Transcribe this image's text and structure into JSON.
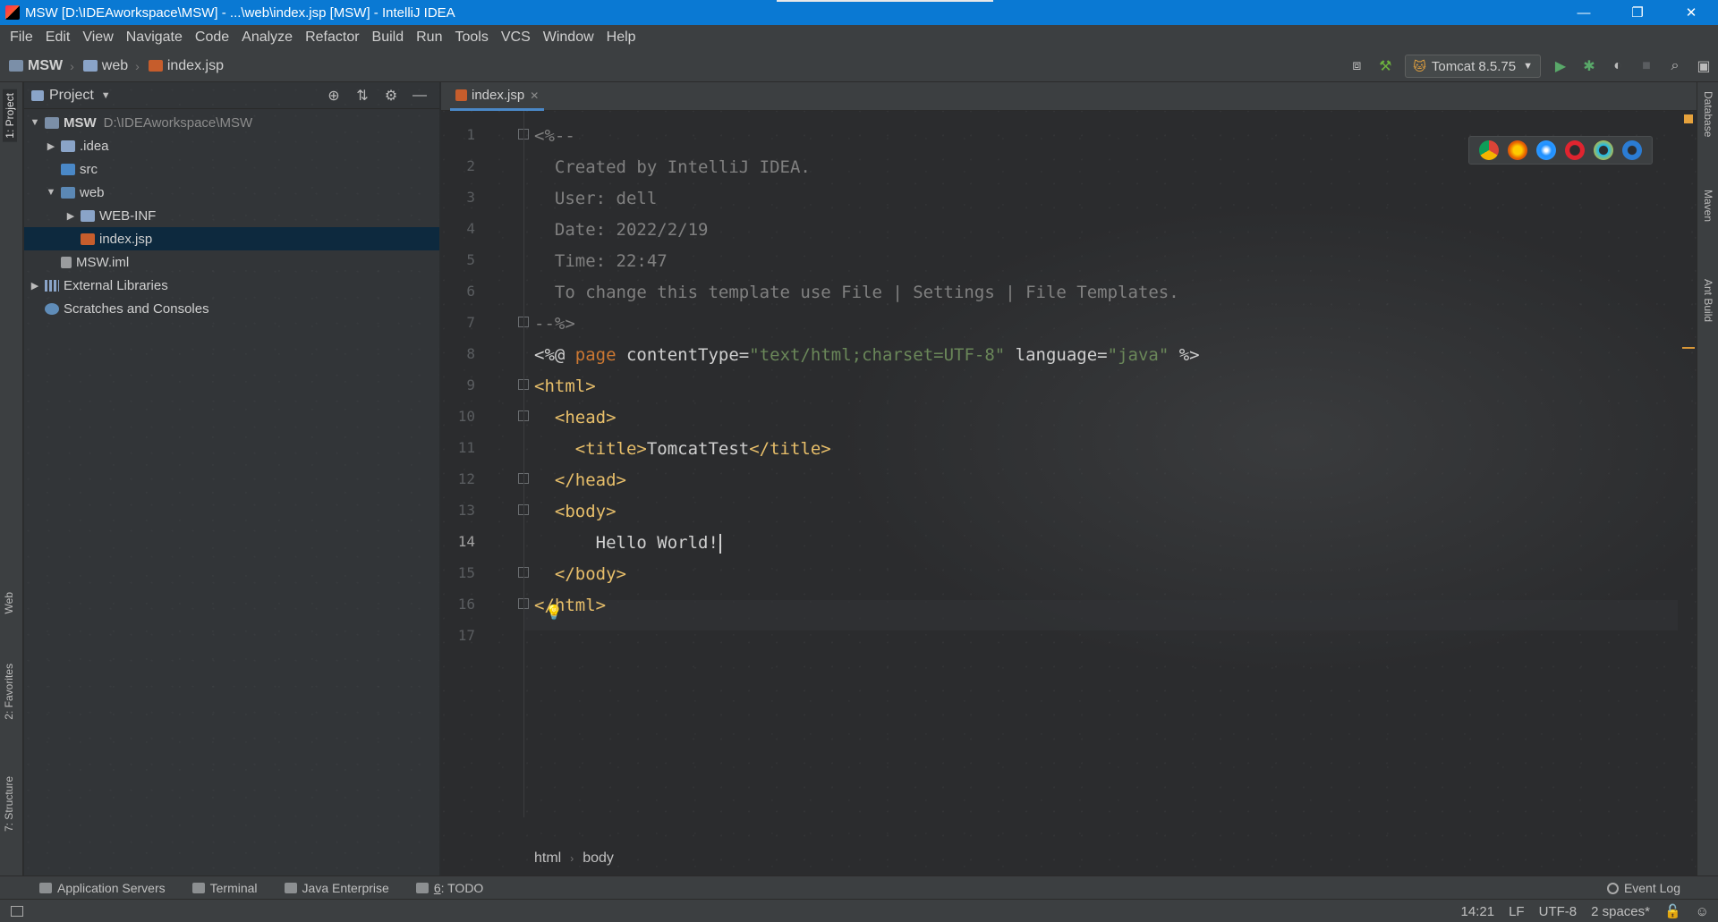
{
  "window": {
    "title": "MSW [D:\\IDEAworkspace\\MSW] - ...\\web\\index.jsp [MSW] - IntelliJ IDEA",
    "minimize": "—",
    "restore": "❐",
    "close": "✕"
  },
  "menu": [
    "File",
    "Edit",
    "View",
    "Navigate",
    "Code",
    "Analyze",
    "Refactor",
    "Build",
    "Run",
    "Tools",
    "VCS",
    "Window",
    "Help"
  ],
  "navbar": {
    "crumbs": [
      "MSW",
      "web",
      "index.jsp"
    ],
    "run_config": "Tomcat 8.5.75"
  },
  "left_stripe": {
    "project_tab": "1: Project",
    "web_tab": "Web",
    "favorites_tab": "2: Favorites",
    "structure_tab": "7: Structure"
  },
  "right_stripe": {
    "database_tab": "Database",
    "maven_tab": "Maven",
    "ant_tab": "Ant Build"
  },
  "project_panel": {
    "title": "Project",
    "tree": [
      {
        "label": "MSW",
        "path": "D:\\IDEAworkspace\\MSW",
        "depth": 0,
        "arrow": "▼",
        "type": "module"
      },
      {
        "label": ".idea",
        "depth": 1,
        "arrow": "▶",
        "type": "folder"
      },
      {
        "label": "src",
        "depth": 1,
        "arrow": "",
        "type": "folder-src"
      },
      {
        "label": "web",
        "depth": 1,
        "arrow": "▼",
        "type": "folder-web"
      },
      {
        "label": "WEB-INF",
        "depth": 2,
        "arrow": "▶",
        "type": "folder"
      },
      {
        "label": "index.jsp",
        "depth": 2,
        "arrow": "",
        "type": "jsp",
        "selected": true
      },
      {
        "label": "MSW.iml",
        "depth": 1,
        "arrow": "",
        "type": "iml"
      },
      {
        "label": "External Libraries",
        "depth": 0,
        "arrow": "▶",
        "type": "lib"
      },
      {
        "label": "Scratches and Consoles",
        "depth": 0,
        "arrow": "",
        "type": "scratch"
      }
    ]
  },
  "editor": {
    "tab_label": "index.jsp",
    "current_line": 14,
    "line_numbers": [
      "1",
      "2",
      "3",
      "4",
      "5",
      "6",
      "7",
      "8",
      "9",
      "10",
      "11",
      "12",
      "13",
      "14",
      "15",
      "16",
      "17"
    ],
    "lines": {
      "l1": "<%--",
      "l2": "  Created by IntelliJ IDEA.",
      "l3": "  User: dell",
      "l4": "  Date: 2022/2/19",
      "l5": "  Time: 22:47",
      "l6": "  To change this template use File | Settings | File Templates.",
      "l7": "--%>",
      "l8_open": "<%@ ",
      "l8_page": "page",
      "l8_ct": " contentType=",
      "l8_ctv": "\"text/html;charset=UTF-8\"",
      "l8_lang": " language=",
      "l8_langv": "\"java\"",
      "l8_close": " %>",
      "l9": "<html>",
      "l10": "  <head>",
      "l11_open": "    <title>",
      "l11_text": "TomcatTest",
      "l11_close": "</title>",
      "l12": "  </head>",
      "l13": "  <body>",
      "l14": "      Hello World!",
      "l15": "  </body>",
      "l16": "</html>"
    },
    "breadcrumbs": [
      "html",
      "body"
    ]
  },
  "bottom_tools": {
    "app_servers": "Application Servers",
    "terminal": "Terminal",
    "java_ee": "Java Enterprise",
    "todo_num": "6",
    "todo_label": ": TODO",
    "event_log": "Event Log"
  },
  "status": {
    "position": "14:21",
    "line_sep": "LF",
    "encoding": "UTF-8",
    "indent": "2 spaces*"
  },
  "colors": {
    "titlebar": "#0a79d3",
    "jsp_icon": "#c65d2c",
    "tag": "#e8bf6a",
    "comment": "#808080",
    "string": "#6a8759",
    "keyword": "#cc7832"
  }
}
